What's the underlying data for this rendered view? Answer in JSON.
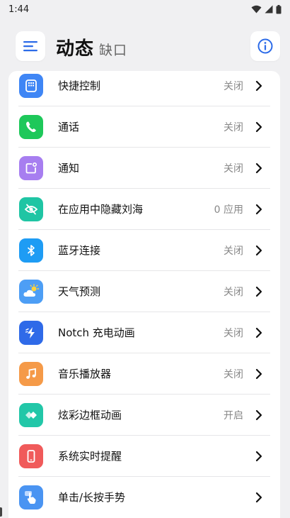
{
  "status_bar": {
    "time": "1:44"
  },
  "header": {
    "title": "动态",
    "subtitle": "缺口"
  },
  "items": [
    {
      "label": "快捷控制",
      "value": "关闭",
      "icon": "quick-control-icon",
      "color": "#3f86f5"
    },
    {
      "label": "通话",
      "value": "关闭",
      "icon": "phone-icon",
      "color": "#1ec85a"
    },
    {
      "label": "通知",
      "value": "关闭",
      "icon": "notification-icon",
      "color": "#a77ef0"
    },
    {
      "label": "在应用中隐藏刘海",
      "value": "0 应用",
      "icon": "eye-hidden-icon",
      "color": "#1fc5a4"
    },
    {
      "label": "蓝牙连接",
      "value": "关闭",
      "icon": "bluetooth-icon",
      "color": "#1e9cf4"
    },
    {
      "label": "天气预测",
      "value": "关闭",
      "icon": "weather-icon",
      "color": "#4d9ef5"
    },
    {
      "label": "Notch 充电动画",
      "value": "关闭",
      "icon": "charging-icon",
      "color": "#2f6ae8"
    },
    {
      "label": "音乐播放器",
      "value": "关闭",
      "icon": "music-icon",
      "color": "#f59a48"
    },
    {
      "label": "炫彩边框动画",
      "value": "开启",
      "icon": "border-animation-icon",
      "color": "#22c7a8"
    },
    {
      "label": "系统实时提醒",
      "value": "",
      "icon": "phone-alert-icon",
      "color": "#f05a5a"
    },
    {
      "label": "单击/长按手势",
      "value": "",
      "icon": "gesture-icon",
      "color": "#4a94f2"
    }
  ]
}
